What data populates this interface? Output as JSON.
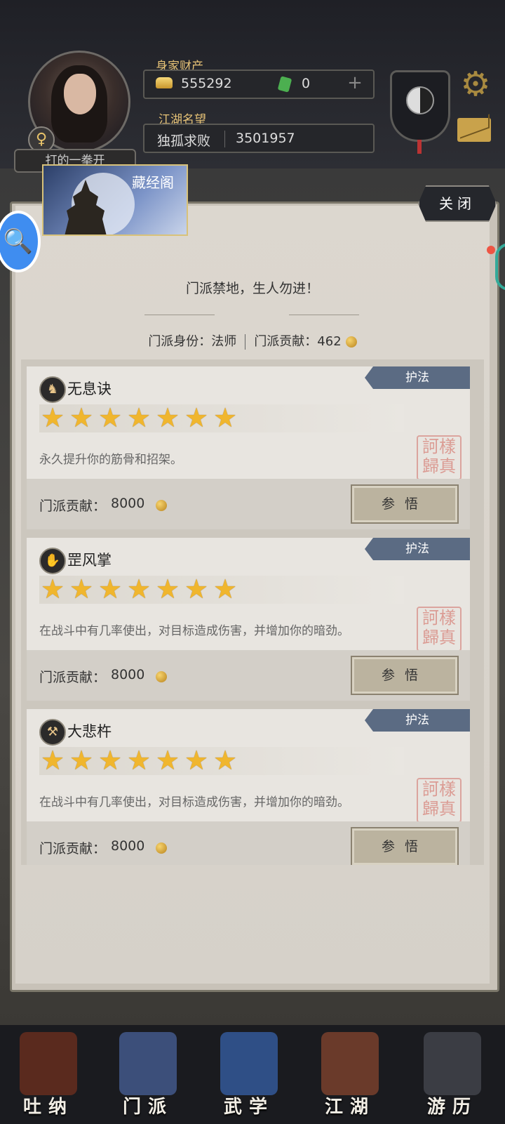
{
  "header": {
    "wealth_label": "身家财产",
    "gold_value": "555292",
    "jade_value": "0",
    "add_symbol": "+",
    "fame_label": "江湖名望",
    "fame_title": "独孤求败",
    "fame_value": "3501957",
    "player_name": "打的一拳开",
    "gender_symbol": "♀"
  },
  "dialog": {
    "banner_title": "藏经阁",
    "close_label": "关闭",
    "motto": "门派禁地，生人勿进！",
    "identity": "门派身份：法师",
    "contribution": "门派贡献：462"
  },
  "skills": [
    {
      "name": "无息诀",
      "tag": "护法",
      "stars": 7,
      "icon": "warrior-icon",
      "description": "永久提升你的筋骨和招架。",
      "cost_label": "门派贡献：",
      "cost_value": "8000",
      "button_label": "参悟"
    },
    {
      "name": "罡风掌",
      "tag": "护法",
      "stars": 7,
      "icon": "palm-icon",
      "description": "在战斗中有几率使出，对目标造成伤害，并增加你的暗劲。",
      "cost_label": "门派贡献：",
      "cost_value": "8000",
      "button_label": "参悟"
    },
    {
      "name": "大悲杵",
      "tag": "护法",
      "stars": 7,
      "icon": "pestle-icon",
      "description": "在战斗中有几率使出，对目标造成伤害，并增加你的暗劲。",
      "cost_label": "门派贡献：",
      "cost_value": "8000",
      "button_label": "参悟"
    }
  ],
  "seal_text": "訶樣歸真",
  "nav": [
    "吐纳",
    "门派",
    "武学",
    "江湖",
    "游历"
  ],
  "colors": {
    "tag": "#5b6b83",
    "star": "#f0b62e",
    "gold_text": "#e7c377"
  }
}
